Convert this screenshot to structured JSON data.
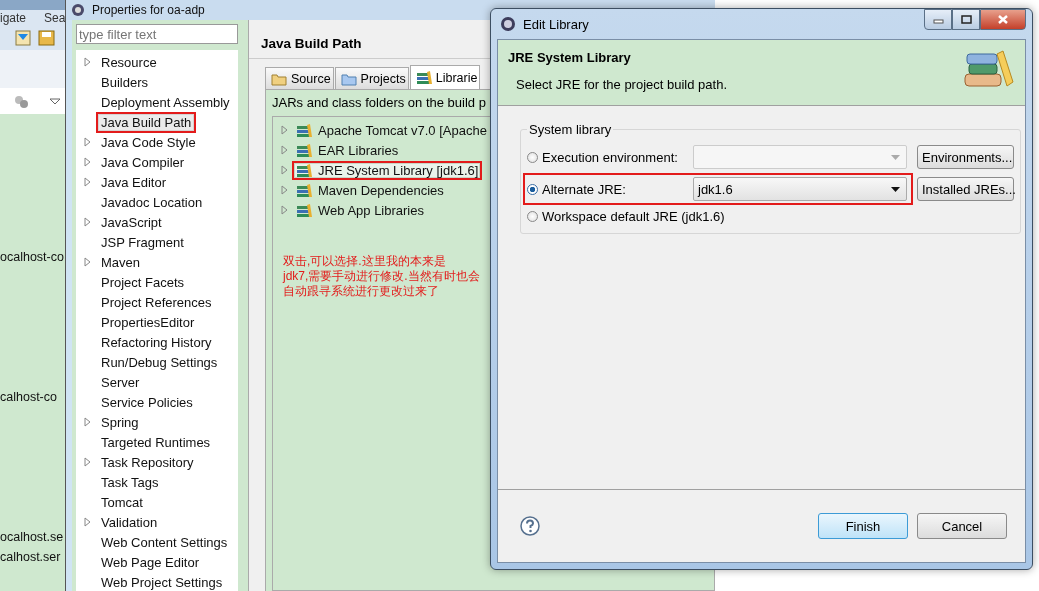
{
  "background_ide": {
    "menu": [
      "igate",
      "Sea"
    ],
    "editor_lines": [
      "ocalhost-co",
      "calhost-co",
      "ocalhost.se",
      "calhost.ser"
    ]
  },
  "properties_window": {
    "title": "Properties for oa-adp",
    "filter": {
      "placeholder": "type filter text"
    },
    "tree": [
      {
        "label": "Resource",
        "expandable": true,
        "selected": false,
        "highlighted": false
      },
      {
        "label": "Builders",
        "expandable": false,
        "selected": false,
        "highlighted": false
      },
      {
        "label": "Deployment Assembly",
        "expandable": false,
        "selected": false,
        "highlighted": false
      },
      {
        "label": "Java Build Path",
        "expandable": false,
        "selected": true,
        "highlighted": true
      },
      {
        "label": "Java Code Style",
        "expandable": true,
        "selected": false,
        "highlighted": false
      },
      {
        "label": "Java Compiler",
        "expandable": true,
        "selected": false,
        "highlighted": false
      },
      {
        "label": "Java Editor",
        "expandable": true,
        "selected": false,
        "highlighted": false
      },
      {
        "label": "Javadoc Location",
        "expandable": false,
        "selected": false,
        "highlighted": false
      },
      {
        "label": "JavaScript",
        "expandable": true,
        "selected": false,
        "highlighted": false
      },
      {
        "label": "JSP Fragment",
        "expandable": false,
        "selected": false,
        "highlighted": false
      },
      {
        "label": "Maven",
        "expandable": true,
        "selected": false,
        "highlighted": false
      },
      {
        "label": "Project Facets",
        "expandable": false,
        "selected": false,
        "highlighted": false
      },
      {
        "label": "Project References",
        "expandable": false,
        "selected": false,
        "highlighted": false
      },
      {
        "label": "PropertiesEditor",
        "expandable": false,
        "selected": false,
        "highlighted": false
      },
      {
        "label": "Refactoring History",
        "expandable": false,
        "selected": false,
        "highlighted": false
      },
      {
        "label": "Run/Debug Settings",
        "expandable": false,
        "selected": false,
        "highlighted": false
      },
      {
        "label": "Server",
        "expandable": false,
        "selected": false,
        "highlighted": false
      },
      {
        "label": "Service Policies",
        "expandable": false,
        "selected": false,
        "highlighted": false
      },
      {
        "label": "Spring",
        "expandable": true,
        "selected": false,
        "highlighted": false
      },
      {
        "label": "Targeted Runtimes",
        "expandable": false,
        "selected": false,
        "highlighted": false
      },
      {
        "label": "Task Repository",
        "expandable": true,
        "selected": false,
        "highlighted": false
      },
      {
        "label": "Task Tags",
        "expandable": false,
        "selected": false,
        "highlighted": false
      },
      {
        "label": "Tomcat",
        "expandable": false,
        "selected": false,
        "highlighted": false
      },
      {
        "label": "Validation",
        "expandable": true,
        "selected": false,
        "highlighted": false
      },
      {
        "label": "Web Content Settings",
        "expandable": false,
        "selected": false,
        "highlighted": false
      },
      {
        "label": "Web Page Editor",
        "expandable": false,
        "selected": false,
        "highlighted": false
      },
      {
        "label": "Web Project Settings",
        "expandable": false,
        "selected": false,
        "highlighted": false
      }
    ],
    "page_title": "Java Build Path",
    "tabs": [
      {
        "label": "Source",
        "kind": "source",
        "selected": false
      },
      {
        "label": "Projects",
        "kind": "projects",
        "selected": false
      },
      {
        "label": "Librarie",
        "kind": "libraries",
        "selected": true
      }
    ],
    "description": "JARs and class folders on the build p",
    "libraries": [
      {
        "label": "Apache Tomcat v7.0 [Apache",
        "selected": false,
        "highlighted": false
      },
      {
        "label": "EAR Libraries",
        "selected": false,
        "highlighted": false
      },
      {
        "label": "JRE System Library [jdk1.6]",
        "selected": true,
        "highlighted": true
      },
      {
        "label": "Maven Dependencies",
        "selected": false,
        "highlighted": false
      },
      {
        "label": "Web App Libraries",
        "selected": false,
        "highlighted": false
      }
    ],
    "annotation": [
      "双击,可以选择.这里我的本来是",
      "jdk7,需要手动进行修改.当然有时也会",
      "自动跟寻系统进行更改过来了"
    ]
  },
  "dialog": {
    "title": "Edit Library",
    "header_title": "JRE System Library",
    "header_subtitle": "Select JRE for the project build path.",
    "group_label": "System library",
    "options": [
      {
        "label": "Execution environment:",
        "kind": "combo",
        "selected": false,
        "highlighted": false,
        "combo": {
          "disabled": true
        },
        "button": "Environments..."
      },
      {
        "label": "Alternate JRE:",
        "kind": "combo",
        "selected": true,
        "highlighted": true,
        "combo": {
          "value": "jdk1.6",
          "disabled": false
        },
        "button": "Installed JREs..."
      },
      {
        "label": "Workspace default JRE (jdk1.6)",
        "kind": "plain",
        "selected": false,
        "highlighted": false
      }
    ],
    "buttons": [
      {
        "label": "Finish",
        "default": true
      },
      {
        "label": "Cancel",
        "default": false
      }
    ]
  }
}
